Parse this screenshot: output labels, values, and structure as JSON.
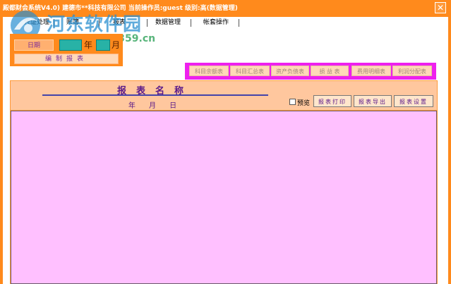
{
  "window": {
    "title": "殿都财会系统V4.0) 建德市**科技有限公司  当前操作员:guest  级别:高(数据管理)",
    "close_glyph": "✕"
  },
  "watermark": {
    "site_name": "河东软件园",
    "url": "www.pc0359.cn"
  },
  "menu": {
    "tabs": [
      "凭证处理",
      "账簿",
      "报表",
      "数据管理",
      "帐套操作"
    ]
  },
  "date_panel": {
    "date_label": "日期",
    "year_value": "",
    "year_unit": "年",
    "month_value": "",
    "month_unit": "月",
    "compile_label": "编制报表"
  },
  "report_types": [
    "科目余额表",
    "科目汇总表",
    "资产负债表",
    "损 益 表",
    "费用明细表",
    "利润分配表"
  ],
  "report": {
    "title": "报表名称",
    "date_line": "年 月 日",
    "preview_label": "预览",
    "preview_checked": false,
    "print_label": "报表打印",
    "export_label": "报表导出",
    "settings_label": "报表设置"
  },
  "colors": {
    "accent": "#ff8a1c",
    "panel_magenta": "#ee20ee",
    "input_teal": "#28b2a6",
    "report_body": "#ffc0ff"
  }
}
